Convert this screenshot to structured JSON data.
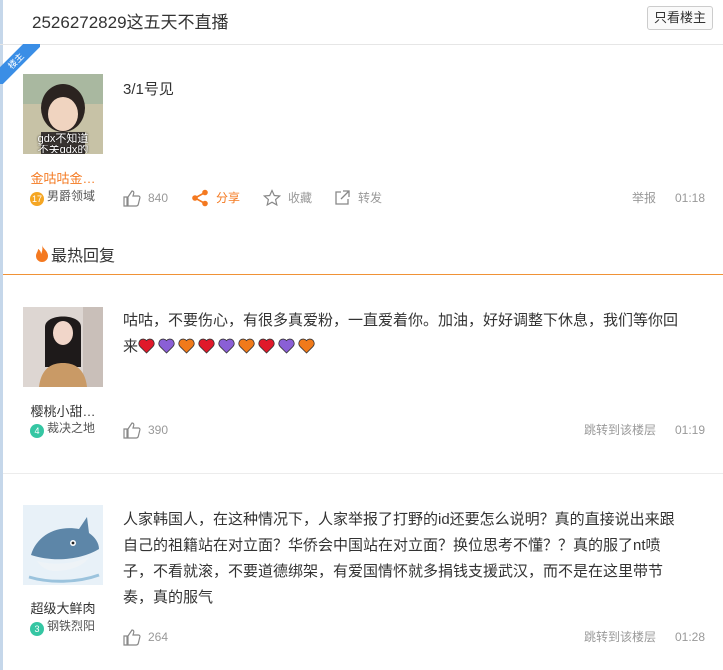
{
  "header": {
    "title": "2526272829这五天不直播",
    "only_op_label": "只看楼主",
    "op_badge": "楼主"
  },
  "hot_section_title": "最热回复",
  "colors": {
    "accent": "#f47920",
    "level_blue": "#2ab0d8",
    "level_green": "#35c6a3"
  },
  "posts": [
    {
      "username": "金咕咕金…",
      "badge_level": "17",
      "badge_text": "男爵领域",
      "avatar_caption": "gdx不知道",
      "avatar_caption_2": "不关gdx的",
      "content": "3/1号见",
      "likes": "840",
      "share_label": "分享",
      "fav_label": "收藏",
      "forward_label": "转发",
      "report_label": "举报",
      "time": "01:18"
    },
    {
      "username": "樱桃小甜…",
      "badge_level": "4",
      "badge_text": "裁决之地",
      "content": "咕咕，不要伤心，有很多真爱粉，一直爱着你。加油，好好调整下休息，我们等你回来",
      "hearts": [
        "red",
        "purple",
        "orange",
        "red",
        "purple",
        "orange",
        "red",
        "purple",
        "orange"
      ],
      "likes": "390",
      "jump_label": "跳转到该楼层",
      "time": "01:19"
    },
    {
      "username": "超级大鲜肉",
      "badge_level": "3",
      "badge_text": "钢铁烈阳",
      "content": "人家韩国人，在这种情况下，人家举报了打野的id还要怎么说明？真的直接说出来跟自己的祖籍站在对立面？华侨会中国站在对立面？换位思考不懂？？真的服了nt喷子，不看就滚，不要道德绑架，有爱国情怀就多捐钱支援武汉，而不是在这里带节奏，真的服气",
      "likes": "264",
      "jump_label": "跳转到该楼层",
      "time": "01:28"
    }
  ]
}
